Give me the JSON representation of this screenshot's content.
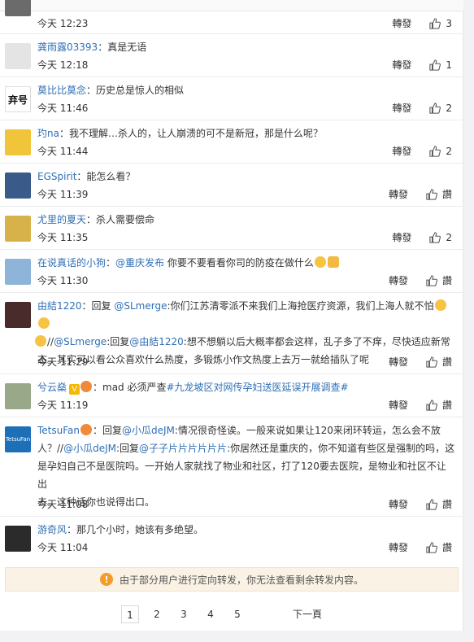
{
  "comments": [
    {
      "name": "",
      "text": "",
      "time": "今天 12:23",
      "repost": "轉發",
      "likes": "3"
    },
    {
      "name": "龚雨露03393",
      "text": "：真是无语",
      "time": "今天 12:18",
      "repost": "轉發",
      "likes": "1"
    },
    {
      "name": "莫比比莫念",
      "text": "：历史总是惊人的相似",
      "time": "今天 11:46",
      "repost": "轉發",
      "likes": "2",
      "avatar_text": "弃号"
    },
    {
      "name": "玓na",
      "text": "：我不理解…杀人的，让人崩溃的可不是新冠，那是什么呢？",
      "time": "今天 11:44",
      "repost": "轉發",
      "likes": "2"
    },
    {
      "name": "EGSpirit",
      "text": "：能怎么看？",
      "time": "今天 11:39",
      "repost": "轉發",
      "likes": "讚"
    },
    {
      "name": "尤里的夏天",
      "text": "：杀人需要偿命",
      "time": "今天 11:35",
      "repost": "轉發",
      "likes": "2"
    },
    {
      "name": "在说真话的小狗",
      "text_pre": "：",
      "mention": "@重庆发布",
      "text_post": " 你要不要看看你司的防疫在做什么",
      "time": "今天 11:30",
      "repost": "轉發",
      "likes": "讚"
    },
    {
      "name": "由結1220",
      "line1_pre": "：回复 ",
      "line1_mention": "@SLmerge",
      "line1_post": ":你们江苏清零派不来我们上海抢医疗资源，我们上海人就不怕",
      "line2_pre": "//",
      "line2_mention": "@SLmerge",
      "line2_mid": ":回复",
      "line2_mention2": "@由結1220",
      "line2_post": ":想不想躺以后大概率都会这样，乱子多了不痒，尽快适应新常",
      "line3": "态。其实可以看公众喜欢什么热度，多锻炼小作文热度上去万一就给插队了呢",
      "time": "今天 11:29",
      "repost": "轉發",
      "likes": "讚"
    },
    {
      "name": "兮云燊",
      "text_pre": "：mad 必须严查",
      "topic": "#九龙坡区对网传孕妇送医延误开展调查#",
      "time": "今天 11:19",
      "repost": "轉發",
      "likes": "讚"
    },
    {
      "name": "TetsuFan",
      "avatar_text": "TetsuFan",
      "line1_pre": "：回复",
      "line1_mention": "@小瓜deJM",
      "line1_post": ":情况很奇怪诶。一般来说如果让120来闭环转运，怎么会不放",
      "line2_pre": "人？//",
      "line2_mention": "@小瓜deJM",
      "line2_mid": ":回复",
      "line2_mention2": "@子子片片片片片片",
      "line2_post": ":你居然还是重庆的，你不知道有些区是强制的吗，这",
      "line3": "是孕妇自己不是医院吗。一开始人家就找了物业和社区，打了120要去医院，是物业和社区不让出",
      "line4": "去。这种话你也说得出口。",
      "time": "今天 11:08",
      "repost": "轉發",
      "likes": "讚"
    },
    {
      "name": "游奇风",
      "text": "：那几个小时，她该有多绝望。",
      "time": "今天 11:04",
      "repost": "轉發",
      "likes": "讚"
    }
  ],
  "notice": {
    "text": "由于部分用户进行定向转发，你无法查看剩余转发内容。",
    "icon": "warning-icon"
  },
  "pager": {
    "pages": [
      "1",
      "2",
      "3",
      "4",
      "5"
    ],
    "current": "1",
    "next": "下一頁"
  },
  "colors": {
    "link": "#2f6fb5",
    "notice_bg": "#fbf2e6",
    "warn": "#f39c2c"
  }
}
